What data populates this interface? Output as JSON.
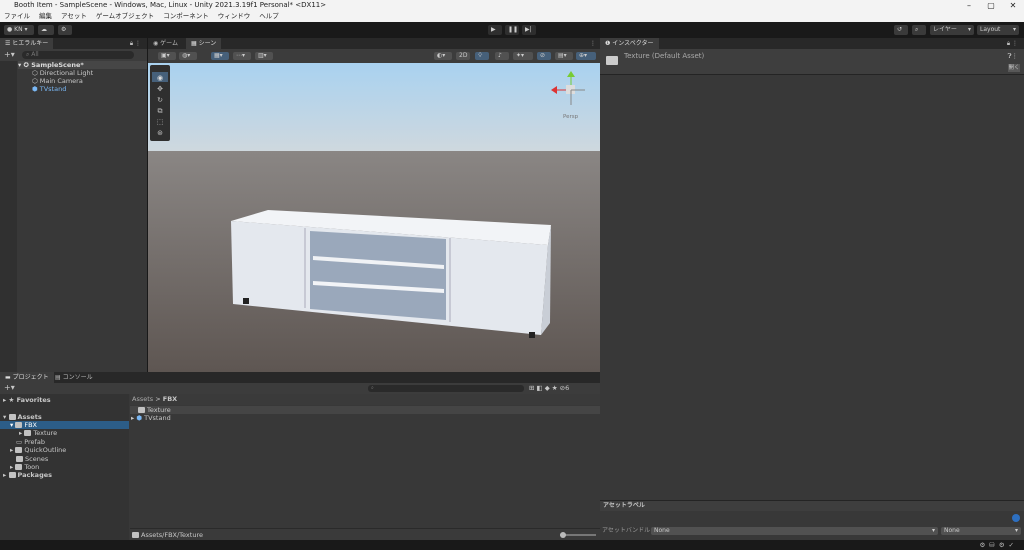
{
  "window": {
    "title": "Booth Item - SampleScene - Windows, Mac, Linux - Unity 2021.3.19f1 Personal* <DX11>"
  },
  "menu": [
    "ファイル",
    "編集",
    "アセット",
    "ゲームオブジェクト",
    "コンポーネント",
    "ウィンドウ",
    "ヘルプ"
  ],
  "toolbar": {
    "account": "KN",
    "layers": "レイヤー",
    "layout": "Layout"
  },
  "hierarchy": {
    "tab": "ヒエラルキー",
    "search_placeholder": "All",
    "scene": "SampleScene*",
    "items": [
      "Directional Light",
      "Main Camera",
      "TVstand"
    ]
  },
  "scene_view": {
    "tabs": [
      "ゲーム",
      "シーン"
    ],
    "mode_2d": "2D",
    "gizmo_label": "Persp"
  },
  "inspector": {
    "tab": "インスペクター",
    "asset_name": "Texture (Default Asset)",
    "open_button": "開く",
    "asset_labels": "アセットラベル",
    "asset_bundle_label": "アセットバンドル",
    "bundle_value": "None",
    "variant_value": "None"
  },
  "project": {
    "tabs": [
      "プロジェクト",
      "コンソール"
    ],
    "favorites": "Favorites",
    "assets": "Assets",
    "tree": [
      "FBX",
      "Texture",
      "Prefab",
      "QuickOutline",
      "Scenes",
      "Toon"
    ],
    "packages": "Packages",
    "breadcrumb": [
      "Assets",
      "FBX"
    ],
    "files": [
      "Texture",
      "TVstand"
    ],
    "path": "Assets/FBX/Texture",
    "hidden_count": "6"
  }
}
